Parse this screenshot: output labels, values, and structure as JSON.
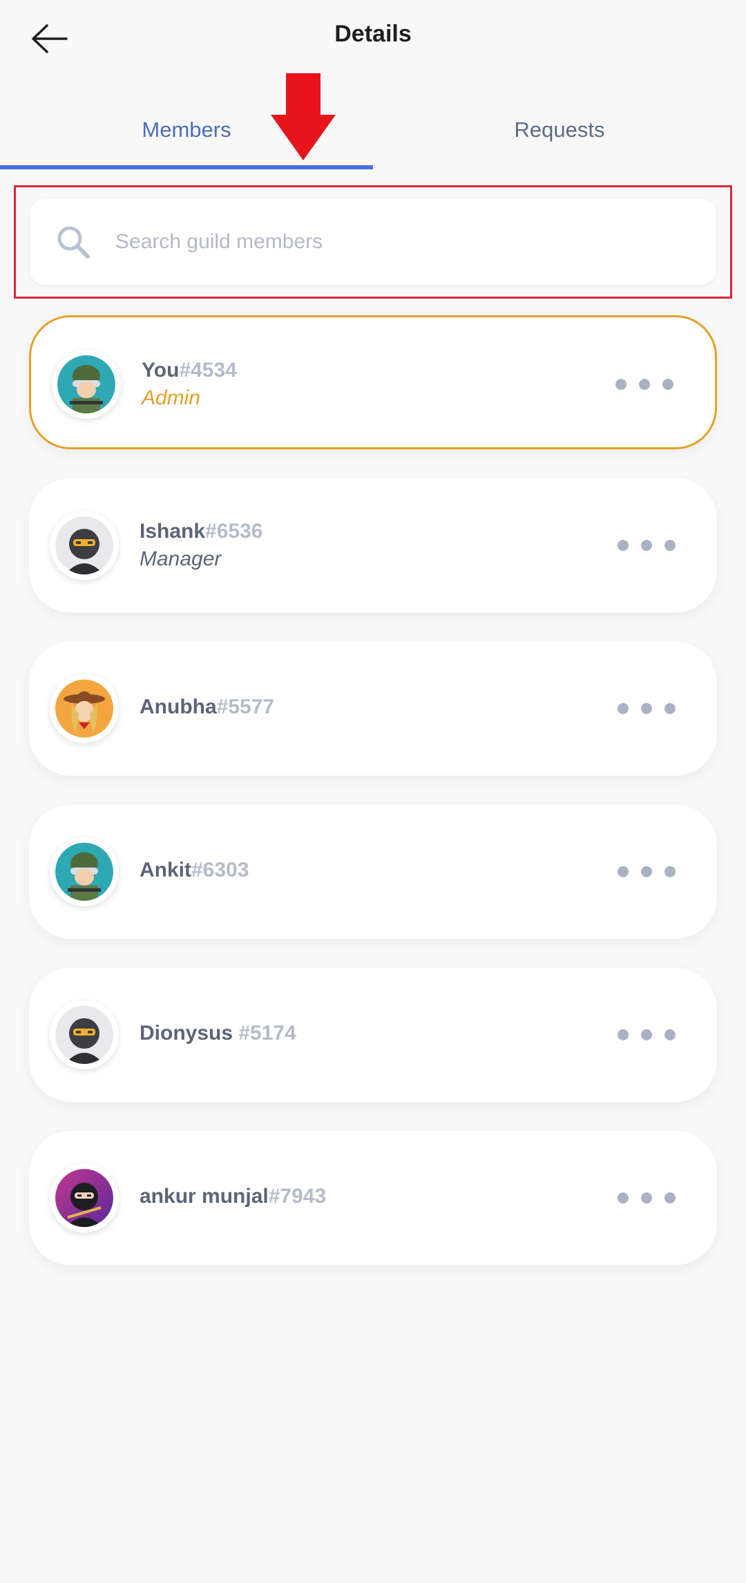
{
  "header": {
    "title": "Details",
    "back_icon": "arrow-left-icon"
  },
  "tabs": [
    {
      "label": "Members",
      "active": true
    },
    {
      "label": "Requests",
      "active": false
    }
  ],
  "search": {
    "placeholder": "Search guild members",
    "value": "",
    "icon": "search-icon"
  },
  "annotations": {
    "arrow_color": "#e8141c",
    "highlight_color": "#d62839"
  },
  "colors": {
    "accent": "#4a6ed9",
    "admin": "#e5a028"
  },
  "members": [
    {
      "name": "You",
      "tag": "#4534",
      "role": "Admin",
      "avatar": "soldier-avatar"
    },
    {
      "name": "Ishank",
      "tag": "#6536",
      "role": "Manager",
      "avatar": "ninja-avatar"
    },
    {
      "name": "Anubha",
      "tag": "#5577",
      "role": "",
      "avatar": "cowgirl-avatar"
    },
    {
      "name": "Ankit",
      "tag": "#6303",
      "role": "",
      "avatar": "soldier-avatar"
    },
    {
      "name": "Dionysus ",
      "tag": "#5174",
      "role": "",
      "avatar": "ninja-avatar"
    },
    {
      "name": "ankur munjal",
      "tag": "#7943",
      "role": "",
      "avatar": "purple-ninja-avatar"
    }
  ]
}
